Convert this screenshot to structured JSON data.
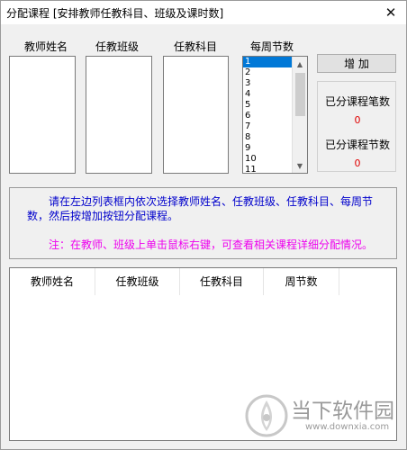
{
  "window": {
    "title": "分配课程 [安排教师任教科目、班级及课时数]",
    "close_glyph": "✕"
  },
  "columns": {
    "teacher_label": "教师姓名",
    "class_label": "任教班级",
    "subject_label": "任教科目",
    "weekly_label": "每周节数"
  },
  "weekly_list": {
    "items": [
      "1",
      "2",
      "3",
      "4",
      "5",
      "6",
      "7",
      "8",
      "9",
      "10",
      "11"
    ],
    "selected": "1"
  },
  "add_button": {
    "label": "增 加"
  },
  "stats": {
    "count_label": "已分课程笔数",
    "count_value": "0",
    "periods_label": "已分课程节数",
    "periods_value": "0"
  },
  "info": {
    "instruction": "请在左边列表框内依次选择教师姓名、任教班级、任教科目、每周节数，然后按增加按钮分配课程。",
    "note": "注：在教师、班级上单击鼠标右键，可查看相关课程详细分配情况。"
  },
  "grid": {
    "headers": [
      "教师姓名",
      "任教班级",
      "任教科目",
      "周节数"
    ]
  },
  "watermark": {
    "name": "当下软件园",
    "url": "www.downxia.com"
  },
  "colors": {
    "info_blue": "#0000cc",
    "note_magenta": "#ee00ee",
    "stat_red": "#e00000",
    "selection": "#0078d7"
  },
  "icons": {
    "close": "close-icon",
    "scroll_up": "scroll-up-arrow-icon",
    "scroll_down": "scroll-down-arrow-icon",
    "watermark_logo": "downxia-logo-icon"
  }
}
